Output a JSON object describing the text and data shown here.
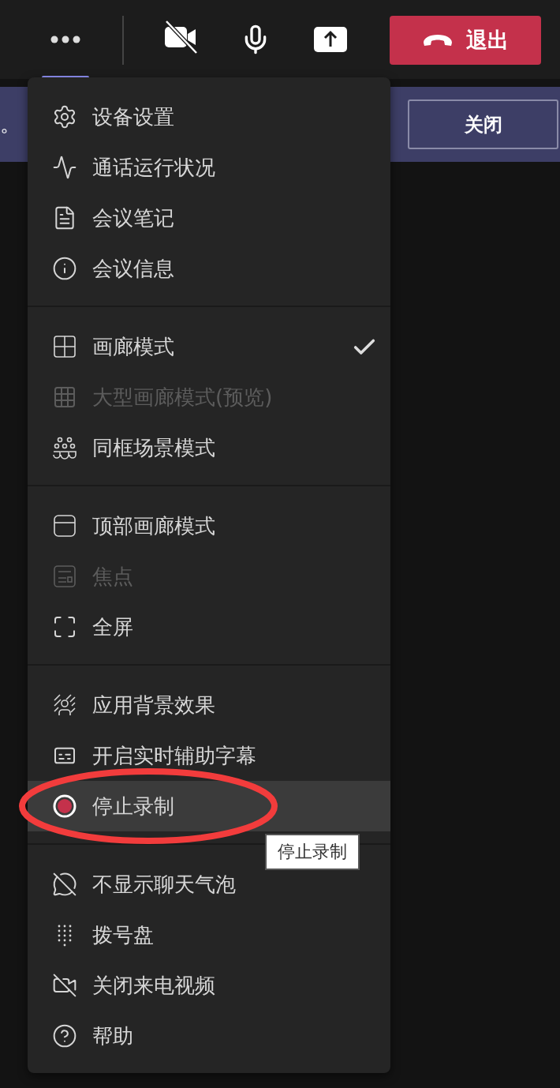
{
  "toolbar": {
    "items": [
      {
        "kind": "more",
        "selected": true
      },
      {
        "kind": "camera",
        "selected": false
      },
      {
        "kind": "mic",
        "selected": false
      },
      {
        "kind": "share",
        "selected": false
      }
    ],
    "leave_button": "退出"
  },
  "banner": {
    "text": "。",
    "close_button": "关闭"
  },
  "menu": {
    "sections": [
      {
        "items": [
          {
            "label": "设备设置",
            "disabled": false,
            "checked": false,
            "hovered": false,
            "circled": false
          },
          {
            "label": "通话运行状况",
            "disabled": false,
            "checked": false,
            "hovered": false,
            "circled": false
          },
          {
            "label": "会议笔记",
            "disabled": false,
            "checked": false,
            "hovered": false,
            "circled": false
          },
          {
            "label": "会议信息",
            "disabled": false,
            "checked": false,
            "hovered": false,
            "circled": false
          }
        ]
      },
      {
        "items": [
          {
            "label": "画廊模式",
            "disabled": false,
            "checked": true,
            "hovered": false,
            "circled": false
          },
          {
            "label": "大型画廊模式(预览)",
            "disabled": true,
            "checked": false,
            "hovered": false,
            "circled": false
          },
          {
            "label": "同框场景模式",
            "disabled": false,
            "checked": false,
            "hovered": false,
            "circled": false
          }
        ]
      },
      {
        "items": [
          {
            "label": "顶部画廊模式",
            "disabled": false,
            "checked": false,
            "hovered": false,
            "circled": false
          },
          {
            "label": "焦点",
            "disabled": true,
            "checked": false,
            "hovered": false,
            "circled": false
          },
          {
            "label": "全屏",
            "disabled": false,
            "checked": false,
            "hovered": false,
            "circled": false
          }
        ]
      },
      {
        "items": [
          {
            "label": "应用背景效果",
            "disabled": false,
            "checked": false,
            "hovered": false,
            "circled": false
          },
          {
            "label": "开启实时辅助字幕",
            "disabled": false,
            "checked": false,
            "hovered": false,
            "circled": false
          },
          {
            "label": "停止录制",
            "disabled": false,
            "checked": false,
            "hovered": true,
            "circled": true
          }
        ]
      },
      {
        "items": [
          {
            "label": "不显示聊天气泡",
            "disabled": false,
            "checked": false,
            "hovered": false,
            "circled": false
          },
          {
            "label": "拨号盘",
            "disabled": false,
            "checked": false,
            "hovered": false,
            "circled": false
          },
          {
            "label": "关闭来电视频",
            "disabled": false,
            "checked": false,
            "hovered": false,
            "circled": false
          },
          {
            "label": "帮助",
            "disabled": false,
            "checked": false,
            "hovered": false,
            "circled": false
          }
        ]
      }
    ]
  },
  "tooltip": "停止录制"
}
